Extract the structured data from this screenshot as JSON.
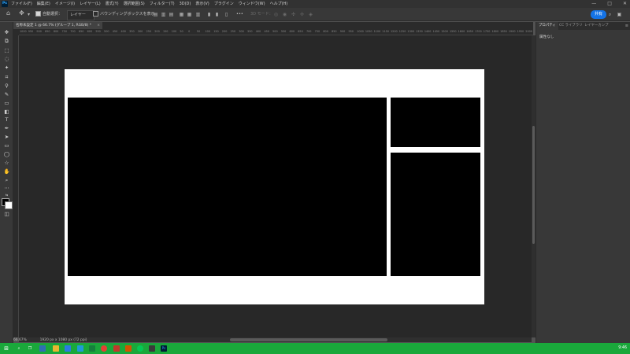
{
  "app": {
    "logo": "Ps"
  },
  "menu": [
    "ファイル(F)",
    "編集(E)",
    "イメージ(I)",
    "レイヤー(L)",
    "書式(Y)",
    "選択範囲(S)",
    "フィルター(T)",
    "3D(D)",
    "表示(V)",
    "プラグイン",
    "ウィンドウ(W)",
    "ヘルプ(H)"
  ],
  "window_controls": {
    "minimize": "—",
    "maximize": "□",
    "close": "✕"
  },
  "options": {
    "auto_select_label": "自動選択：",
    "auto_select_checked": true,
    "target_select": "レイヤー",
    "bounding_box_label": "バウンディングボックスを表示",
    "bounding_box_checked": false,
    "mode_3d_label": "3D モード：",
    "more": "•••",
    "share_label": "共有"
  },
  "document_tab": {
    "title": "名称未設定 1 @ 66.7% (グループ 1, RGB/8) *",
    "close": "×"
  },
  "ruler": {
    "top_labels": [
      "1000",
      "950",
      "900",
      "850",
      "800",
      "750",
      "700",
      "650",
      "600",
      "550",
      "500",
      "450",
      "400",
      "350",
      "300",
      "250",
      "200",
      "150",
      "100",
      "50",
      "0",
      "50",
      "100",
      "150",
      "200",
      "250",
      "300",
      "350",
      "400",
      "450",
      "500",
      "550",
      "600",
      "650",
      "700",
      "750",
      "800",
      "850",
      "900",
      "950",
      "1000",
      "1050",
      "1100",
      "1150",
      "1200",
      "1250",
      "1300",
      "1350",
      "1400",
      "1450",
      "1500",
      "1550",
      "1600",
      "1650",
      "1700",
      "1750",
      "1800",
      "1850",
      "1900",
      "1950",
      "2000"
    ]
  },
  "status": {
    "zoom": "66.67%",
    "doc_info": "1920 px x 1080 px (72 ppi)"
  },
  "panel": {
    "tabs": [
      "プロパティ",
      "CC ライブラリ",
      "レイヤーカンプ"
    ],
    "active_tab": 0,
    "body_text": "属性なし",
    "menu_icon": "≡"
  },
  "taskbar": {
    "clock": "9:46"
  },
  "colors": {
    "foreground": "#000000",
    "background": "#ffffff",
    "accent": "#1473e6",
    "taskbar": "#1aa83b"
  }
}
